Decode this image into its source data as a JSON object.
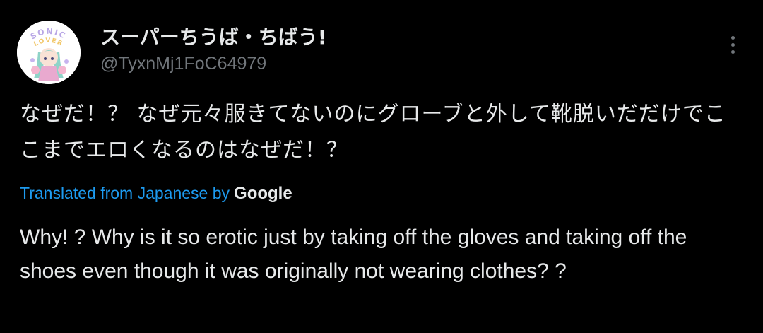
{
  "author": {
    "display_name": "スーパーちうば・ちばう!",
    "handle": "@TyxnMj1FoC64979",
    "avatar_text": "SONIC LOVER"
  },
  "tweet": {
    "text": "なぜだ！？ なぜ元々服きてないのにグローブと外して靴脱いだだけでここまでエロくなるのはなぜだ！？"
  },
  "translation": {
    "label": "Translated from Japanese by",
    "provider": "Google",
    "text": "Why! ? Why is it so erotic just by taking off the gloves and taking off the shoes even though it was originally not wearing clothes? ?"
  },
  "icons": {
    "more": "more-options-icon",
    "avatar": "avatar-image"
  },
  "colors": {
    "background": "#000000",
    "text": "#e7e9ea",
    "secondary": "#71767b",
    "link": "#1d9bf0"
  }
}
